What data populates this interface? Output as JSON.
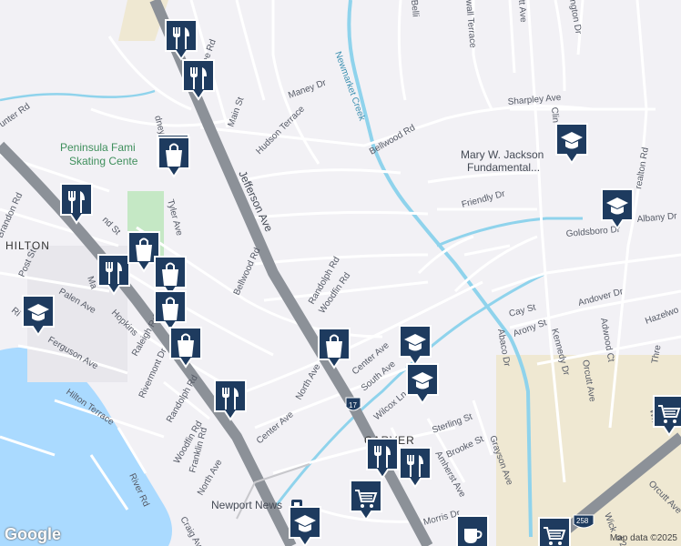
{
  "map": {
    "streets": [
      {
        "id": "main-st",
        "label": "Main St"
      },
      {
        "id": "jefferson-ave",
        "label": "Jefferson Ave"
      },
      {
        "id": "maney-dr",
        "label": "Maney Dr"
      },
      {
        "id": "hudson-terrace",
        "label": "Hudson Terrace"
      },
      {
        "id": "bellwood-rd-1",
        "label": "Bellwood Rd"
      },
      {
        "id": "bellwood-rd-2",
        "label": "Bellwood Rd"
      },
      {
        "id": "randolph-rd-1",
        "label": "Randolph Rd"
      },
      {
        "id": "randolph-rd-2",
        "label": "Randolph Rd"
      },
      {
        "id": "woodfin-rd-1",
        "label": "Woodfin Rd"
      },
      {
        "id": "woodfin-rd-2",
        "label": "Woodfin Rd"
      },
      {
        "id": "center-ave-1",
        "label": "Center Ave"
      },
      {
        "id": "center-ave-2",
        "label": "Center Ave"
      },
      {
        "id": "north-ave-1",
        "label": "North Ave"
      },
      {
        "id": "north-ave-2",
        "label": "North Ave"
      },
      {
        "id": "south-ave",
        "label": "South Ave"
      },
      {
        "id": "wilcox-ln",
        "label": "Wilcox Ln"
      },
      {
        "id": "tyler-ave",
        "label": "Tyler Ave"
      },
      {
        "id": "lee-rd",
        "label": "Lee Rd"
      },
      {
        "id": "post-st",
        "label": "Post St"
      },
      {
        "id": "palen-ave",
        "label": "Palen Ave"
      },
      {
        "id": "ferguson-ave",
        "label": "Ferguson Ave"
      },
      {
        "id": "hilton-terrace",
        "label": "Hilton Terrace"
      },
      {
        "id": "riverside",
        "label": "Ri"
      },
      {
        "id": "hopkins",
        "label": "Hopkins"
      },
      {
        "id": "raleigh-rd",
        "label": "Raleigh Rd"
      },
      {
        "id": "rivermont-dr",
        "label": "Rivermont Dr"
      },
      {
        "id": "franklin-rd",
        "label": "Franklin Rd"
      },
      {
        "id": "river-rd",
        "label": "River Rd"
      },
      {
        "id": "craig-ave",
        "label": "Craig Ave"
      },
      {
        "id": "brandon-rd",
        "label": "Brandon Rd"
      },
      {
        "id": "hunter-rd",
        "label": "unter Rd"
      },
      {
        "id": "nd-st",
        "label": "nd St"
      },
      {
        "id": "ma",
        "label": "Ma"
      },
      {
        "id": "dney-pl",
        "label": "dney Pl"
      },
      {
        "id": "sterling-st",
        "label": "Sterling St"
      },
      {
        "id": "brooke-st",
        "label": "Brooke St"
      },
      {
        "id": "amherst-ave",
        "label": "Amherst Ave"
      },
      {
        "id": "grayson-ave",
        "label": "Grayson Ave"
      },
      {
        "id": "morris-dr",
        "label": "Morris Dr"
      },
      {
        "id": "abaco-dr",
        "label": "Abaco Dr"
      },
      {
        "id": "arony-st",
        "label": "Arony St"
      },
      {
        "id": "cay-st",
        "label": "Cay St"
      },
      {
        "id": "kennedy-dr",
        "label": "Kennedy Dr"
      },
      {
        "id": "andover-dr",
        "label": "Andover Dr"
      },
      {
        "id": "adwood-ct",
        "label": "Adwood Ct"
      },
      {
        "id": "orcutt-ave-1",
        "label": "Orcutt Ave"
      },
      {
        "id": "orcutt-ave-2",
        "label": "Orcutt Ave"
      },
      {
        "id": "hazelwo",
        "label": "Hazelwo"
      },
      {
        "id": "goldsboro-dr",
        "label": "Goldsboro Dr"
      },
      {
        "id": "albany-dr",
        "label": "Albany Dr"
      },
      {
        "id": "friendly-dr",
        "label": "Friendly Dr"
      },
      {
        "id": "sharpley-ave",
        "label": "Sharpley Ave"
      },
      {
        "id": "wall-terrace",
        "label": "wall Terrace"
      },
      {
        "id": "tt-ave",
        "label": "tt Ave"
      },
      {
        "id": "ngton-dr",
        "label": "ngton Dr"
      },
      {
        "id": "belli",
        "label": "Belli"
      },
      {
        "id": "clin",
        "label": "Clin"
      },
      {
        "id": "realton-rd",
        "label": "realton Rd"
      },
      {
        "id": "thre",
        "label": "Thre"
      },
      {
        "id": "wh",
        "label": "Wh"
      },
      {
        "id": "wick",
        "label": "Wick"
      },
      {
        "id": "d2nd-st",
        "label": "d 2nd St"
      }
    ],
    "water_labels": [
      {
        "id": "newmarket-creek",
        "label": "Newmarket Creek"
      }
    ],
    "place_labels": [
      {
        "id": "skating-center",
        "lines": [
          "Peninsula Fami",
          "Skating Cente"
        ]
      },
      {
        "id": "mary-jackson",
        "lines": [
          "Mary W. Jackson",
          "Fundamental..."
        ]
      }
    ],
    "area_labels": [
      {
        "id": "hilton",
        "label": "HILTON"
      },
      {
        "id": "carver",
        "label": "CARVER"
      },
      {
        "id": "newport-news",
        "label": "Newport News"
      }
    ],
    "shields": [
      {
        "id": "route-17",
        "label": "17"
      },
      {
        "id": "route-258",
        "label": "258"
      }
    ],
    "pins": [
      {
        "id": "pin-1",
        "category": "restaurant",
        "icon": "fork-knife-icon"
      },
      {
        "id": "pin-2",
        "category": "restaurant",
        "icon": "fork-knife-icon"
      },
      {
        "id": "pin-3",
        "category": "shopping",
        "icon": "shopping-bag-icon"
      },
      {
        "id": "pin-4",
        "category": "restaurant",
        "icon": "fork-knife-icon"
      },
      {
        "id": "pin-5",
        "category": "shopping",
        "icon": "shopping-bag-icon"
      },
      {
        "id": "pin-6",
        "category": "restaurant",
        "icon": "fork-knife-icon"
      },
      {
        "id": "pin-7",
        "category": "shopping",
        "icon": "shopping-bag-icon"
      },
      {
        "id": "pin-8",
        "category": "shopping",
        "icon": "shopping-bag-icon"
      },
      {
        "id": "pin-9",
        "category": "shopping",
        "icon": "shopping-bag-icon"
      },
      {
        "id": "pin-10",
        "category": "school",
        "icon": "graduation-cap-icon"
      },
      {
        "id": "pin-11",
        "category": "shopping",
        "icon": "shopping-bag-icon"
      },
      {
        "id": "pin-12",
        "category": "restaurant",
        "icon": "fork-knife-icon"
      },
      {
        "id": "pin-13",
        "category": "shopping",
        "icon": "shopping-bag-icon"
      },
      {
        "id": "pin-14",
        "category": "school",
        "icon": "graduation-cap-icon"
      },
      {
        "id": "pin-15",
        "category": "school",
        "icon": "graduation-cap-icon"
      },
      {
        "id": "pin-16",
        "category": "school",
        "icon": "graduation-cap-icon"
      },
      {
        "id": "pin-17",
        "category": "school",
        "icon": "graduation-cap-icon"
      },
      {
        "id": "pin-18",
        "category": "restaurant",
        "icon": "fork-knife-icon"
      },
      {
        "id": "pin-19",
        "category": "restaurant",
        "icon": "fork-knife-icon"
      },
      {
        "id": "pin-20",
        "category": "grocery",
        "icon": "shopping-cart-icon"
      },
      {
        "id": "pin-21",
        "category": "school",
        "icon": "graduation-cap-icon"
      },
      {
        "id": "pin-22",
        "category": "cafe",
        "icon": "coffee-cup-icon"
      },
      {
        "id": "pin-23",
        "category": "grocery",
        "icon": "shopping-cart-icon"
      },
      {
        "id": "pin-24",
        "category": "grocery",
        "icon": "shopping-cart-icon"
      }
    ],
    "colors": {
      "background": "#f2f1f5",
      "water": "#aadaff",
      "creek": "#8fd3ec",
      "highway": "#8c9198",
      "road": "#ffffff",
      "park": "#c5e8c5",
      "industrial": "#efe8d2",
      "pin": "#1e3b5f"
    }
  },
  "attribution": {
    "logo": "Google",
    "copyright": "Map data ©2025"
  }
}
